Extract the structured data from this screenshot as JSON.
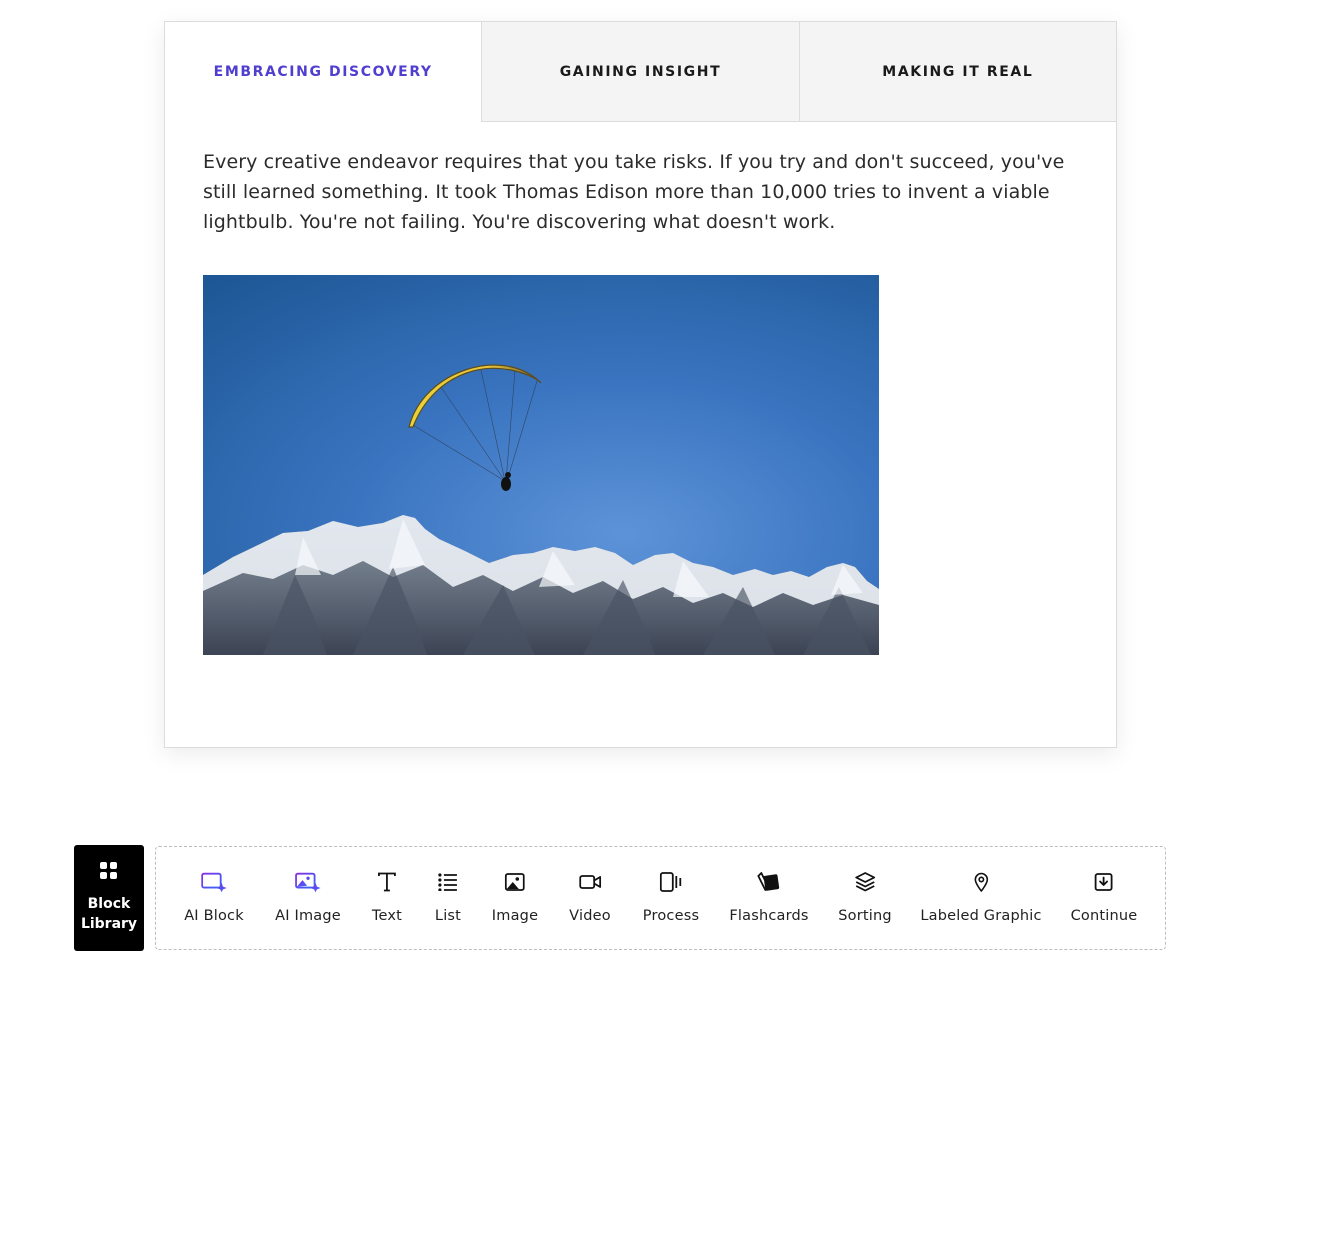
{
  "tabs": [
    {
      "label": "EMBRACING DISCOVERY",
      "active": true
    },
    {
      "label": "GAINING INSIGHT",
      "active": false
    },
    {
      "label": "MAKING IT REAL",
      "active": false
    }
  ],
  "content": {
    "text": "Every creative endeavor requires that you take risks. If you try and don't succeed, you've still learned something. It took Thomas Edison more than 10,000 tries to invent a viable lightbulb. You're not failing. You're discovering what doesn't work."
  },
  "block_library": {
    "label_line1": "Block",
    "label_line2": "Library",
    "icon": "grid-icon"
  },
  "toolbar": {
    "items": [
      {
        "label": "AI Block",
        "icon": "ai-block-icon"
      },
      {
        "label": "AI Image",
        "icon": "ai-image-icon"
      },
      {
        "label": "Text",
        "icon": "text-icon"
      },
      {
        "label": "List",
        "icon": "list-icon"
      },
      {
        "label": "Image",
        "icon": "image-icon"
      },
      {
        "label": "Video",
        "icon": "video-icon"
      },
      {
        "label": "Process",
        "icon": "process-icon"
      },
      {
        "label": "Flashcards",
        "icon": "flashcards-icon"
      },
      {
        "label": "Sorting",
        "icon": "sorting-icon"
      },
      {
        "label": "Labeled Graphic",
        "icon": "labeled-graphic-icon"
      },
      {
        "label": "Continue",
        "icon": "continue-icon"
      }
    ]
  },
  "colors": {
    "accent": "#4f3ed0",
    "ai_gradient_start": "#8a2be2",
    "ai_gradient_end": "#2f6bff"
  }
}
